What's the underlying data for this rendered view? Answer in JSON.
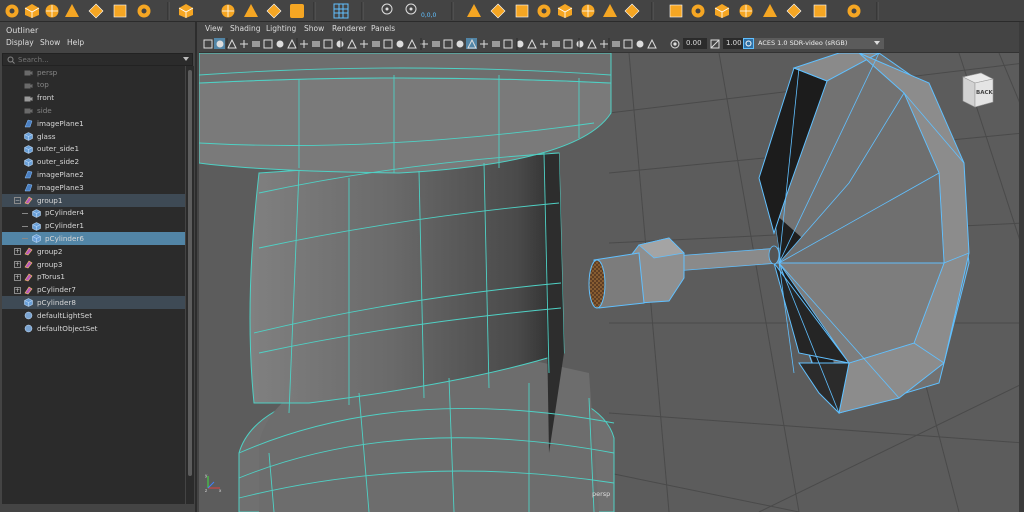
{
  "shelf": {
    "icons": [
      "torus-icon",
      "cube-icon",
      "sphere-icon",
      "cone-icon",
      "polygon-icon",
      "diamond-icon",
      "square-icon",
      "dodecahedron-icon",
      "star-icon",
      "helix-icon",
      "text-type-icon",
      "svg-icon",
      "grid-icon",
      "snap-icon",
      "offset-icon",
      "combine-icon",
      "separate-icon",
      "extract-icon",
      "boolean-icon",
      "smooth-icon",
      "reduce-icon",
      "mirror-icon",
      "bridge-icon",
      "extrude-icon",
      "bevel-icon",
      "bridge-edge-icon",
      "append-icon",
      "fill-hole-icon",
      "multicut-icon",
      "knife-icon",
      "uv-icon"
    ],
    "offset_label": "0,0,0"
  },
  "outliner": {
    "title": "Outliner",
    "menu": {
      "display": "Display",
      "show": "Show",
      "help": "Help"
    },
    "search_placeholder": "Search...",
    "items": [
      {
        "label": "persp",
        "type": "camera",
        "dim": true
      },
      {
        "label": "top",
        "type": "camera",
        "dim": true
      },
      {
        "label": "front",
        "type": "camera",
        "dim": false
      },
      {
        "label": "side",
        "type": "camera",
        "dim": true
      },
      {
        "label": "imagePlane1",
        "type": "imageplane"
      },
      {
        "label": "glass",
        "type": "mesh"
      },
      {
        "label": "outer_side1",
        "type": "mesh"
      },
      {
        "label": "outer_side2",
        "type": "mesh"
      },
      {
        "label": "imagePlane2",
        "type": "imageplane"
      },
      {
        "label": "imagePlane3",
        "type": "imageplane"
      },
      {
        "label": "group1",
        "type": "group",
        "expanded": true,
        "state": "parent-selected"
      },
      {
        "label": "pCylinder4",
        "type": "mesh",
        "child": true
      },
      {
        "label": "pCylinder1",
        "type": "mesh",
        "child": true
      },
      {
        "label": "pCylinder6",
        "type": "mesh",
        "child": true,
        "state": "selected"
      },
      {
        "label": "group2",
        "type": "group",
        "collapsed": true
      },
      {
        "label": "group3",
        "type": "group",
        "collapsed": true
      },
      {
        "label": "pTorus1",
        "type": "group",
        "collapsed": true
      },
      {
        "label": "pCylinder7",
        "type": "group",
        "collapsed": true
      },
      {
        "label": "pCylinder8",
        "type": "mesh",
        "state": "parent-selected"
      },
      {
        "label": "defaultLightSet",
        "type": "set"
      },
      {
        "label": "defaultObjectSet",
        "type": "set"
      }
    ]
  },
  "viewport": {
    "menu": [
      "View",
      "Shading",
      "Lighting",
      "Show",
      "Renderer",
      "Panels"
    ],
    "exposure": "0.00",
    "gamma": "1.00",
    "color_management": "ACES 1.0 SDR-video (sRGB)",
    "camera_label": "persp",
    "viewcube_label": "BACK"
  },
  "colors": {
    "selection": "#5285a6",
    "wireframe": "#4fd1c5",
    "accent_orange": "#f5a623",
    "viewport_bg": "#5a5a5a",
    "highlight_wire": "#61c0ff"
  }
}
